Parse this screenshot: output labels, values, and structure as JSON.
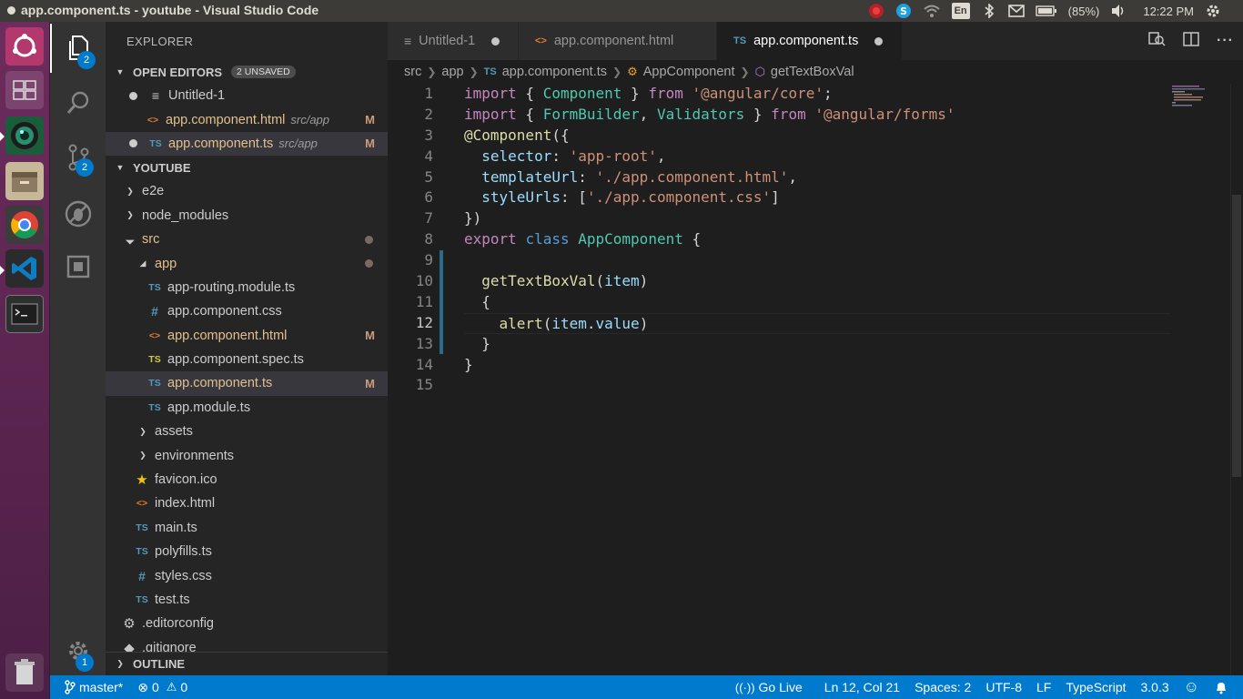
{
  "window": {
    "title": "app.component.ts - youtube - Visual Studio Code"
  },
  "tray": {
    "battery": "(85%)",
    "time": "12:22 PM",
    "keyboard": "En"
  },
  "sidebar": {
    "header": "EXPLORER",
    "open_editors": {
      "title": "OPEN EDITORS",
      "unsaved": "2 UNSAVED",
      "items": [
        {
          "label": "Untitled-1",
          "desc": "",
          "git": ""
        },
        {
          "label": "app.component.html",
          "desc": "src/app",
          "git": "M"
        },
        {
          "label": "app.component.ts",
          "desc": "src/app",
          "git": "M"
        }
      ]
    },
    "workspace": {
      "title": "YOUTUBE",
      "items": [
        {
          "label": "e2e"
        },
        {
          "label": "node_modules"
        },
        {
          "label": "src"
        },
        {
          "label": "app"
        },
        {
          "label": "app-routing.module.ts"
        },
        {
          "label": "app.component.css"
        },
        {
          "label": "app.component.html",
          "git": "M"
        },
        {
          "label": "app.component.spec.ts"
        },
        {
          "label": "app.component.ts",
          "git": "M"
        },
        {
          "label": "app.module.ts"
        },
        {
          "label": "assets"
        },
        {
          "label": "environments"
        },
        {
          "label": "favicon.ico"
        },
        {
          "label": "index.html"
        },
        {
          "label": "main.ts"
        },
        {
          "label": "polyfills.ts"
        },
        {
          "label": "styles.css"
        },
        {
          "label": "test.ts"
        },
        {
          "label": ".editorconfig"
        },
        {
          "label": ".gitignore"
        }
      ]
    },
    "outline": "OUTLINE"
  },
  "activity": {
    "explorer_badge": "2",
    "scm_badge": "2",
    "settings_badge": "1"
  },
  "tabs": [
    {
      "label": "Untitled-1"
    },
    {
      "label": "app.component.html"
    },
    {
      "label": "app.component.ts"
    }
  ],
  "breadcrumb": [
    "src",
    "app",
    "app.component.ts",
    "AppComponent",
    "getTextBoxVal"
  ],
  "editor": {
    "lines": [
      "1",
      "2",
      "3",
      "4",
      "5",
      "6",
      "7",
      "8",
      "9",
      "10",
      "11",
      "12",
      "13",
      "14",
      "15"
    ],
    "current_line": "12"
  },
  "status": {
    "branch": "master*",
    "errors": "0",
    "warnings": "0",
    "golive": "Go Live",
    "position": "Ln 12, Col 21",
    "spaces": "Spaces: 2",
    "encoding": "UTF-8",
    "eol": "LF",
    "language": "TypeScript",
    "version": "3.0.3"
  },
  "colors": {
    "status_bg": "#007acc",
    "sidebar_bg": "#252526",
    "editor_bg": "#1e1e1e",
    "activity_bg": "#333333",
    "launcher_bg": "#5e2750"
  },
  "icons": [
    "ubuntu-dash-icon",
    "files-icon",
    "search-icon",
    "source-control-icon",
    "debug-icon",
    "extensions-icon",
    "settings-gear-icon",
    "chrome-icon",
    "vscode-icon",
    "terminal-icon",
    "trash-icon",
    "file-manager-icon",
    "git-branch-icon",
    "error-icon",
    "warning-icon",
    "broadcast-icon",
    "smiley-icon",
    "bell-icon"
  ]
}
